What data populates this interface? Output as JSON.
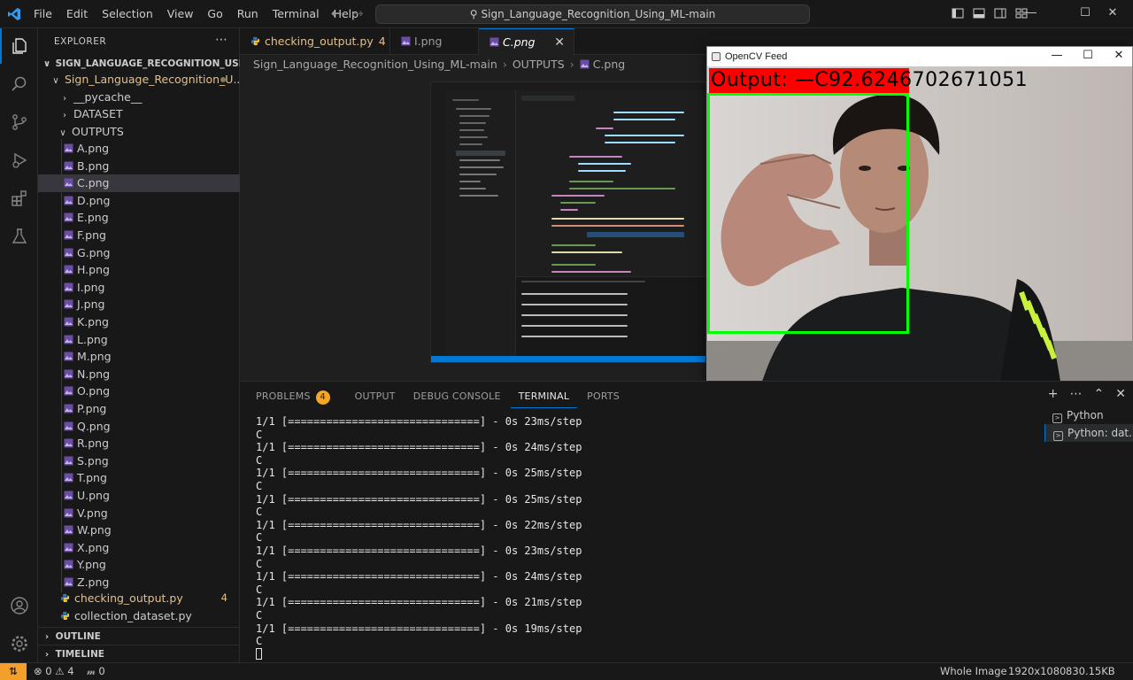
{
  "menu": [
    "File",
    "Edit",
    "Selection",
    "View",
    "Go",
    "Run",
    "Terminal",
    "Help"
  ],
  "search": {
    "text": "Sign_Language_Recognition_Using_ML-main"
  },
  "sidebar": {
    "title": "EXPLORER",
    "root": "SIGN_LANGUAGE_RECOGNITION_USING_M...",
    "project": "Sign_Language_Recognition_U...",
    "folders": {
      "pycache": "__pycache__",
      "dataset": "DATASET",
      "outputs": "OUTPUTS"
    },
    "images": [
      "A.png",
      "B.png",
      "C.png",
      "D.png",
      "E.png",
      "F.png",
      "G.png",
      "H.png",
      "I.png",
      "J.png",
      "K.png",
      "L.png",
      "M.png",
      "N.png",
      "O.png",
      "P.png",
      "Q.png",
      "R.png",
      "S.png",
      "T.png",
      "U.png",
      "V.png",
      "W.png",
      "X.png",
      "Y.png",
      "Z.png"
    ],
    "selected": "C.png",
    "files": [
      {
        "name": "checking_output.py",
        "badge": "4"
      },
      {
        "name": "collection_dataset.py",
        "badge": ""
      }
    ],
    "outline": "OUTLINE",
    "timeline": "TIMELINE"
  },
  "tabs": [
    {
      "label": "checking_output.py",
      "badge": "4"
    },
    {
      "label": "I.png",
      "badge": ""
    },
    {
      "label": "C.png",
      "badge": ""
    }
  ],
  "breadcrumb": {
    "root": "Sign_Language_Recognition_Using_ML-main",
    "folder": "OUTPUTS",
    "file": "C.png"
  },
  "cv_window": {
    "title": "OpenCV Feed",
    "output_text": "Output:  —C92.62467026710 51",
    "output_display": "Output:  —C92.6246702671051"
  },
  "panel": {
    "tabs": [
      "PROBLEMS",
      "OUTPUT",
      "DEBUG CONSOLE",
      "TERMINAL",
      "PORTS"
    ],
    "problems_count": "4",
    "active_tab": "TERMINAL",
    "terminal_lines": [
      "1/1 [==============================] - 0s 23ms/step",
      "C",
      "1/1 [==============================] - 0s 24ms/step",
      "C",
      "1/1 [==============================] - 0s 25ms/step",
      "C",
      "1/1 [==============================] - 0s 25ms/step",
      "C",
      "1/1 [==============================] - 0s 22ms/step",
      "C",
      "1/1 [==============================] - 0s 23ms/step",
      "C",
      "1/1 [==============================] - 0s 24ms/step",
      "C",
      "1/1 [==============================] - 0s 21ms/step",
      "C",
      "1/1 [==============================] - 0s 19ms/step",
      "C"
    ],
    "terminals": [
      "Python",
      "Python: dat..."
    ]
  },
  "status": {
    "errors": "0",
    "warnings": "4",
    "ports": "0",
    "view_mode": "Whole Image",
    "dimensions": "1920x1080",
    "size": "830.15KB"
  },
  "colors": {
    "accent": "#0078d4",
    "remote": "#f2a02b",
    "modified": "#e2c08d",
    "cv_red": "#ff0000",
    "cv_green": "#00ff00"
  }
}
